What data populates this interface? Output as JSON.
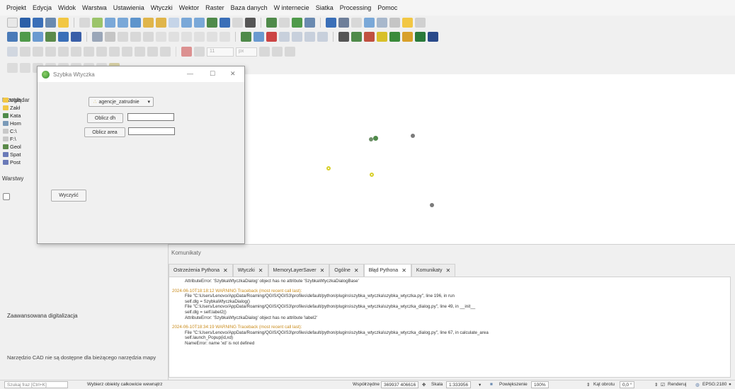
{
  "menu": [
    "Projekt",
    "Edycja",
    "Widok",
    "Warstwa",
    "Ustawienia",
    "Wtyczki",
    "Wektor",
    "Raster",
    "Baza danych",
    "W internecie",
    "Siatka",
    "Processing",
    "Pomoc"
  ],
  "toolbar": {
    "scale_value": "11",
    "unit_value": "px"
  },
  "browser_panel": {
    "title": "Przeglądar",
    "items": [
      "Ulub",
      "Zakł",
      "Kata",
      "Hom",
      "C:\\",
      "F:\\",
      "Geol",
      "Spat",
      "Post"
    ]
  },
  "layers_panel": {
    "title": "Warstwy"
  },
  "digitizing_panel": {
    "title": "Zaawansowana digitalizacja",
    "note": "Narzędzio CAD nie są dostępne dla bieżącego narzędzia mapy"
  },
  "dialog": {
    "title": "Szybka Wtyczka",
    "combo_value": "agencje_zatrudnie",
    "calc_dh_label": "Oblicz dh",
    "calc_area_label": "Oblicz area",
    "clear_label": "Wyczyść"
  },
  "messages": {
    "title": "Komunikaty",
    "tabs": [
      "Ostrzeżenia Pythona",
      "Wtyczki",
      "MemoryLayerSaver",
      "Ogólne",
      "Błąd Pythona",
      "Komunikaty"
    ],
    "active_tab": 4,
    "log": [
      {
        "text": "AttributeError: 'SzybkaWtyczkaDialog' object has no attribute 'SzybkaWtyczkaDialogBase'",
        "cls": "ind"
      },
      {
        "text": "",
        "cls": ""
      },
      {
        "text": "2024-06-10T18:18:12    WARNING    Traceback (most recent call last):",
        "cls": "ts"
      },
      {
        "text": "File \"C:\\Users/Lenovo/AppData/Roaming/QGIS/QGIS3\\profiles\\default/python/plugins\\szybka_wtyczka\\szybka_wtyczka.py\", line 196, in run",
        "cls": "ind"
      },
      {
        "text": "self.dlg = SzybkaWtyczkaDialog()",
        "cls": "ind"
      },
      {
        "text": "File \"C:\\Users/Lenovo/AppData/Roaming/QGIS/QGIS3\\profiles\\default/python/plugins\\szybka_wtyczka\\szybka_wtyczka_dialog.py\", line 49, in __init__",
        "cls": "ind"
      },
      {
        "text": "self.dlg = self.label2()",
        "cls": "ind"
      },
      {
        "text": "AttributeError: 'SzybkaWtyczkaDialog' object has no attribute 'label2'",
        "cls": "ind"
      },
      {
        "text": "",
        "cls": ""
      },
      {
        "text": "2024-06-10T18:34:19    WARNING    Traceback (most recent call last):",
        "cls": "ts"
      },
      {
        "text": "File \"C:\\Users/Lenovo/AppData/Roaming/QGIS/QGIS3\\profiles\\default/python/plugins\\szybka_wtyczka\\szybka_wtyczka_dialog.py\", line 67, in calculate_area",
        "cls": "ind"
      },
      {
        "text": "self.launch_Popup(id,xd)",
        "cls": "ind"
      },
      {
        "text": "NameError: name 'xd' is not defined",
        "cls": "ind"
      }
    ]
  },
  "status": {
    "search_placeholder": "Szukaj fraz [Ctrl+K]",
    "hint": "Wybierz obiekty całkowicie wewnątrz",
    "coord_label": "Współrzędne",
    "coord_value": "369937 406616",
    "scale_label": "Skala",
    "scale_value": "1:333956",
    "magnifier_label": "Powiększenie",
    "magnifier_value": "100%",
    "rotation_label": "Kąt obrotu",
    "rotation_value": "0,0 °",
    "render_label": "Renderuj",
    "crs_label": "EPSG:2180"
  },
  "colors": {
    "point_gray": "#7b7b7b",
    "point_green": "#4f8a4a",
    "point_yellow": "#d8d02a",
    "warning_orange": "#c98b1b"
  }
}
